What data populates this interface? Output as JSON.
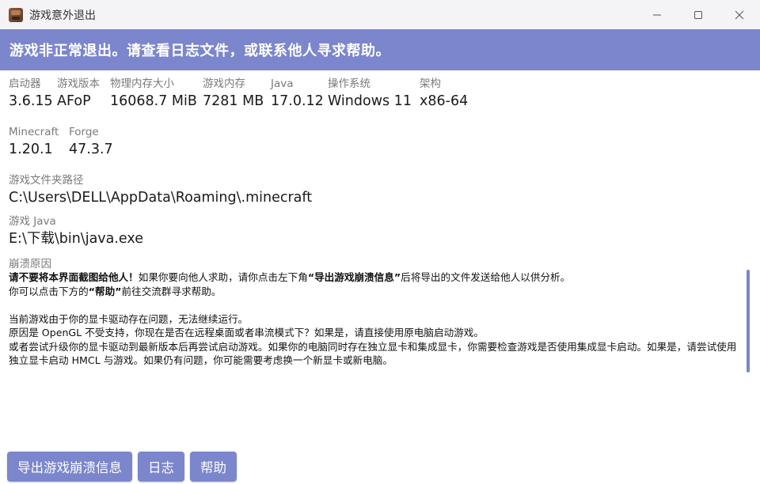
{
  "window": {
    "title": "游戏意外退出",
    "icon": "minecraft-grass-block-icon",
    "controls": [
      "minimize-icon",
      "maximize-icon",
      "close-icon"
    ]
  },
  "header": {
    "text": "游戏非正常退出。请查看日志文件，或联系他人寻求帮助。",
    "color": "#7b86cc"
  },
  "info": {
    "row1": [
      {
        "label": "启动器",
        "value": "3.6.15"
      },
      {
        "label": "游戏版本",
        "value": "AFoP"
      },
      {
        "label": "物理内存大小",
        "value": "16068.7 MiB"
      },
      {
        "label": "游戏内存",
        "value": "7281 MB"
      },
      {
        "label": "Java",
        "value": "17.0.12"
      },
      {
        "label": "操作系统",
        "value": "Windows 11"
      },
      {
        "label": "架构",
        "value": "x86-64"
      }
    ],
    "row2": [
      {
        "label": "Minecraft",
        "value": "1.20.1"
      },
      {
        "label": "Forge",
        "value": "47.3.7"
      }
    ],
    "game_dir": {
      "label": "游戏文件夹路径",
      "value": "C:\\Users\\DELL\\AppData\\Roaming\\.minecraft"
    },
    "java_path": {
      "label": "游戏 Java",
      "value": "E:\\下载\\bin\\java.exe"
    }
  },
  "crash": {
    "label": "崩溃原因",
    "line1_bold": "请不要将本界面截图给他人！",
    "line1_a": "如果你要向他人求助，请你点击左下角",
    "line1_quote": "“导出游戏崩溃信息”",
    "line1_b": "后将导出的文件发送给他人以供分析。",
    "line2_a": "你可以点击下方的",
    "line2_quote": "“帮助”",
    "line2_b": "前往交流群寻求帮助。",
    "line3": "当前游戏由于你的显卡驱动存在问题，无法继续运行。",
    "line4": "原因是 OpenGL 不受支持，你现在是否在远程桌面或者串流模式下？如果是，请直接使用原电脑启动游戏。",
    "line5": "或者尝试升级你的显卡驱动到最新版本后再尝试启动游戏。如果你的电脑同时存在独立显卡和集成显卡，你需要检查游戏是否使用集成显卡启动。如果是，请尝试使用独立显卡启动 HMCL 与游戏。如果仍有问题，你可能需要考虑换一个新显卡或新电脑。"
  },
  "footer": {
    "export_label": "导出游戏崩溃信息",
    "log_label": "日志",
    "help_label": "帮助"
  }
}
